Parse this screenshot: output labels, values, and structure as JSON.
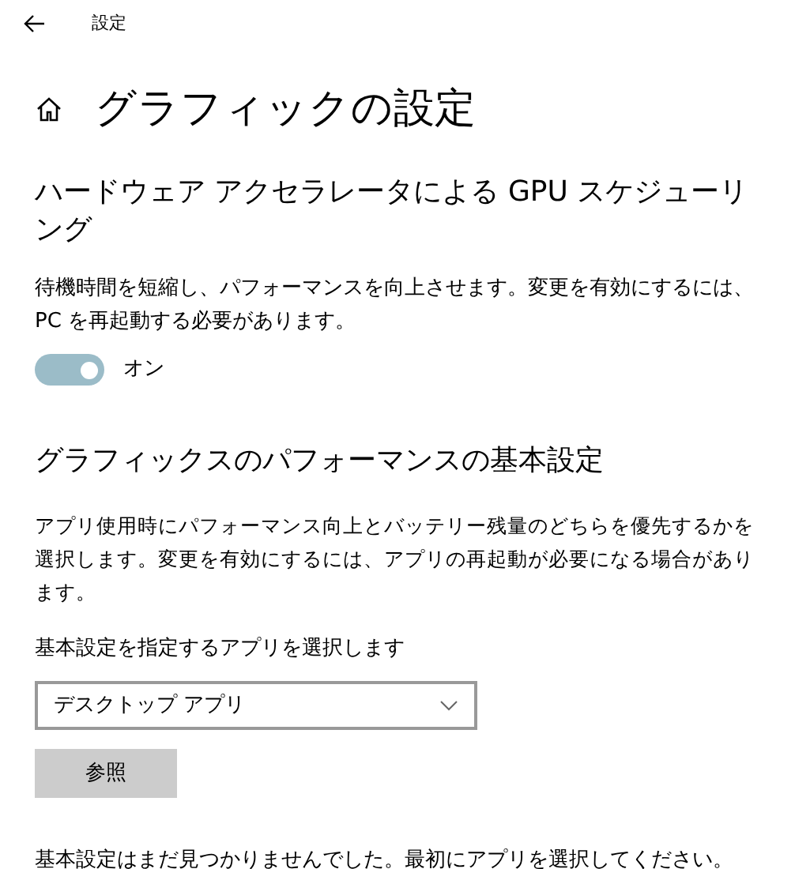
{
  "window": {
    "title": "設定"
  },
  "page_title": "グラフィックの設定",
  "gpu_section": {
    "heading": "ハードウェア アクセラレータによる GPU スケジューリング",
    "description": "待機時間を短縮し、パフォーマンスを向上させます。変更を有効にするには、PC を再起動する必要があります。",
    "toggle": {
      "on": true,
      "label": "オン"
    }
  },
  "performance_section": {
    "heading": "グラフィックスのパフォーマンスの基本設定",
    "description": "アプリ使用時にパフォーマンス向上とバッテリー残量のどちらを優先するかを選択します。変更を有効にするには、アプリの再起動が必要になる場合があります。",
    "select_label": "基本設定を指定するアプリを選択します",
    "select_value": "デスクトップ アプリ",
    "browse_button": "参照",
    "empty_message": "基本設定はまだ見つかりませんでした。最初にアプリを選択してください。"
  }
}
